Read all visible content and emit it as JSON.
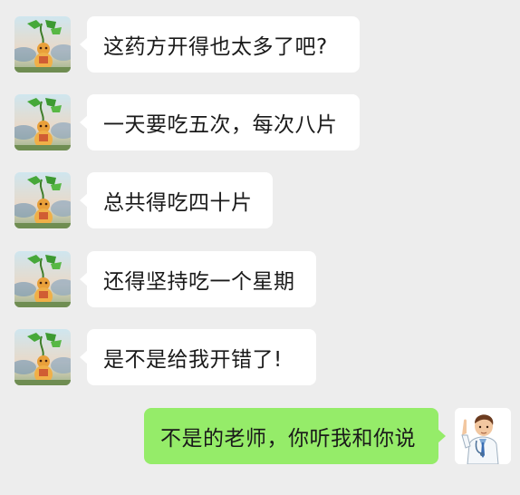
{
  "chat": {
    "messages": [
      {
        "side": "incoming",
        "text": "这药方开得也太多了吧?"
      },
      {
        "side": "incoming",
        "text": "一天要吃五次，每次八片"
      },
      {
        "side": "incoming",
        "text": "总共得吃四十片"
      },
      {
        "side": "incoming",
        "text": "还得坚持吃一个星期"
      },
      {
        "side": "incoming",
        "text": "是不是给我开错了!"
      },
      {
        "side": "outgoing",
        "text": "不是的老师，你听我和你说"
      }
    ],
    "colors": {
      "background": "#ededed",
      "incoming_bubble": "#ffffff",
      "outgoing_bubble": "#95ec69"
    },
    "avatars": {
      "incoming": "gourd-character-avatar",
      "outgoing": "doctor-avatar"
    }
  }
}
